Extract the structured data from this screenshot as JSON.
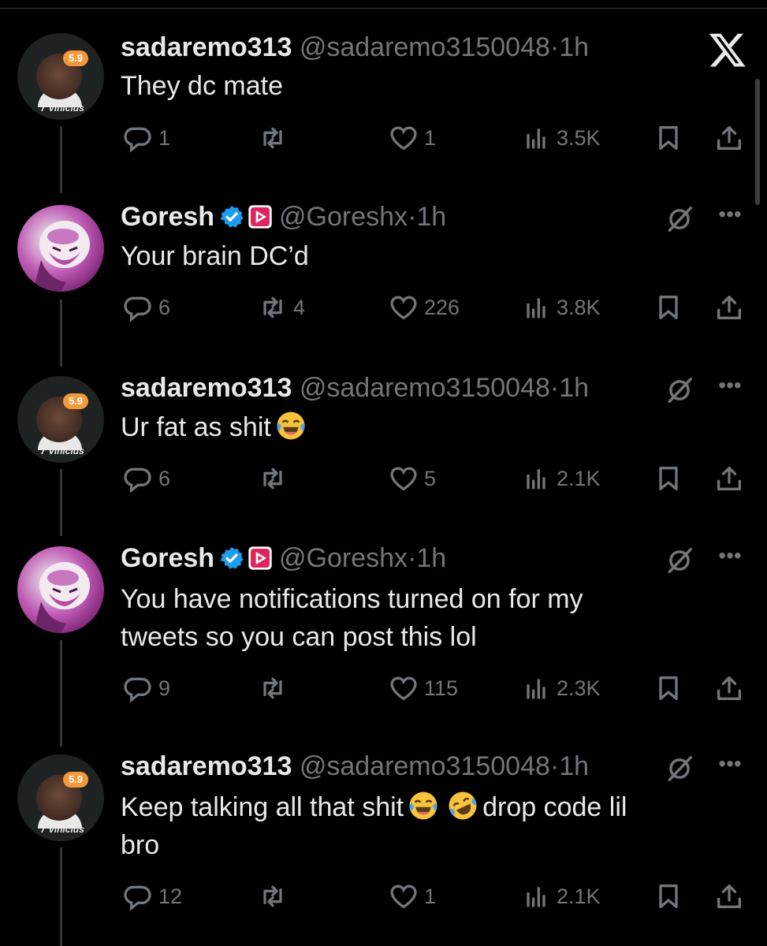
{
  "app": {
    "logo_icon": "x-logo-icon"
  },
  "tweets": [
    {
      "author": "sadaremo313",
      "handle": "@sadaremo3150048",
      "separator": "·",
      "time": "1h",
      "text": "They dc mate",
      "emojis": [],
      "avatar": {
        "badge": "5.9",
        "label": "7 Vinicius"
      },
      "verified": false,
      "affiliate": false,
      "show_grok": false,
      "show_more": false,
      "stats": {
        "replies": "1",
        "retweets": "",
        "likes": "1",
        "views": "3.5K"
      }
    },
    {
      "author": "Goresh",
      "handle": "@Goreshx",
      "separator": "·",
      "time": "1h",
      "text": "Your brain DC’d",
      "emojis": [],
      "avatar": {
        "badge": "",
        "label": ""
      },
      "verified": true,
      "affiliate": true,
      "show_grok": true,
      "show_more": true,
      "stats": {
        "replies": "6",
        "retweets": "4",
        "likes": "226",
        "views": "3.8K"
      }
    },
    {
      "author": "sadaremo313",
      "handle": "@sadaremo3150048",
      "separator": "·",
      "time": "1h",
      "text": "Ur fat as shit",
      "emojis": [
        "face-with-tears-of-joy"
      ],
      "avatar": {
        "badge": "5.9",
        "label": "7 Vinicius"
      },
      "verified": false,
      "affiliate": false,
      "show_grok": true,
      "show_more": true,
      "stats": {
        "replies": "6",
        "retweets": "",
        "likes": "5",
        "views": "2.1K"
      }
    },
    {
      "author": "Goresh",
      "handle": "@Goreshx",
      "separator": "·",
      "time": "1h",
      "text_lines": [
        "You have notifications turned on for my",
        "tweets so you can post this lol"
      ],
      "avatar": {
        "badge": "",
        "label": ""
      },
      "verified": true,
      "affiliate": true,
      "show_grok": true,
      "show_more": true,
      "stats": {
        "replies": "9",
        "retweets": "",
        "likes": "115",
        "views": "2.3K"
      }
    },
    {
      "author": "sadaremo313",
      "handle": "@sadaremo3150048",
      "separator": "·",
      "time": "1h",
      "text_part1": "Keep talking all that shit",
      "text_part2": "drop code lil",
      "text_line2": "bro",
      "emojis": [
        "face-with-tears-of-joy",
        "rolling-on-the-floor-laughing"
      ],
      "avatar": {
        "badge": "5.9",
        "label": "7 Vinicius"
      },
      "verified": false,
      "affiliate": false,
      "show_grok": true,
      "show_more": true,
      "stats": {
        "replies": "12",
        "retweets": "",
        "likes": "1",
        "views": "2.1K"
      }
    }
  ],
  "colors": {
    "background": "#000000",
    "text": "#e7e9ea",
    "muted": "#71767b",
    "verified": "#1d9bf0",
    "affiliate": "#e0245e"
  }
}
